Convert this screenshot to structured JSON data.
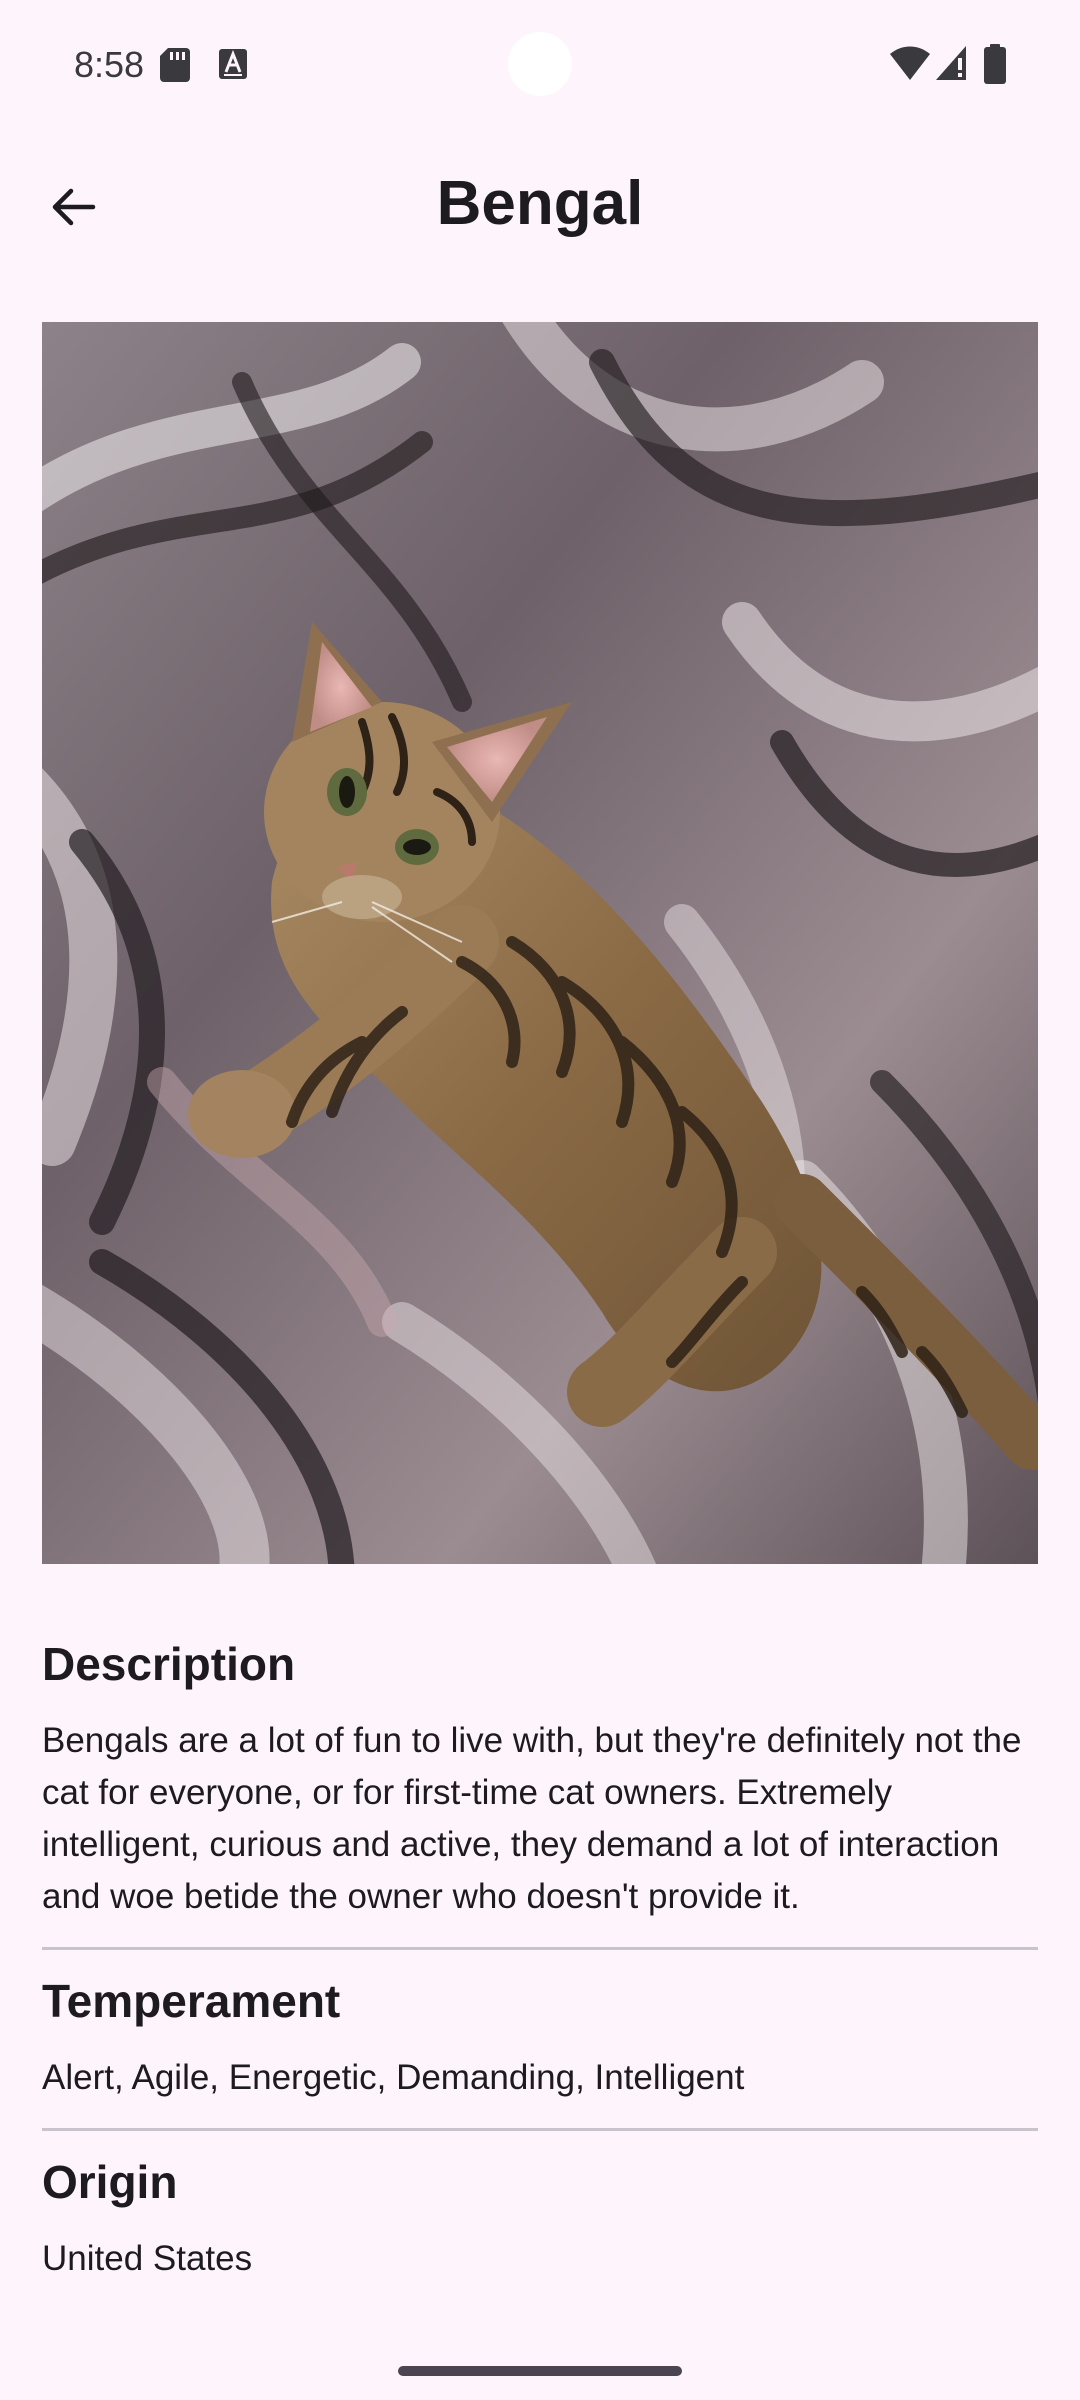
{
  "status_bar": {
    "time": "8:58",
    "icons": [
      "sd-card-icon",
      "font-notification-icon",
      "wifi-icon",
      "cell-signal-icon",
      "battery-icon"
    ]
  },
  "app_bar": {
    "title": "Bengal",
    "back_icon": "arrow-back-icon"
  },
  "image": {
    "description_icon": "cat-photo"
  },
  "sections": {
    "description": {
      "heading": "Description",
      "body": "Bengals are a lot of fun to live with, but they're definitely not the cat for everyone, or for first-time cat owners. Extremely intelligent, curious and active, they demand a lot of interaction and woe betide the owner who doesn't provide it."
    },
    "temperament": {
      "heading": "Temperament",
      "body": "Alert, Agile, Energetic, Demanding, Intelligent"
    },
    "origin": {
      "heading": "Origin",
      "body": "United States"
    }
  },
  "colors": {
    "background": "#fdf5fb",
    "text": "#1d1b20",
    "divider": "#c9c4cc"
  }
}
